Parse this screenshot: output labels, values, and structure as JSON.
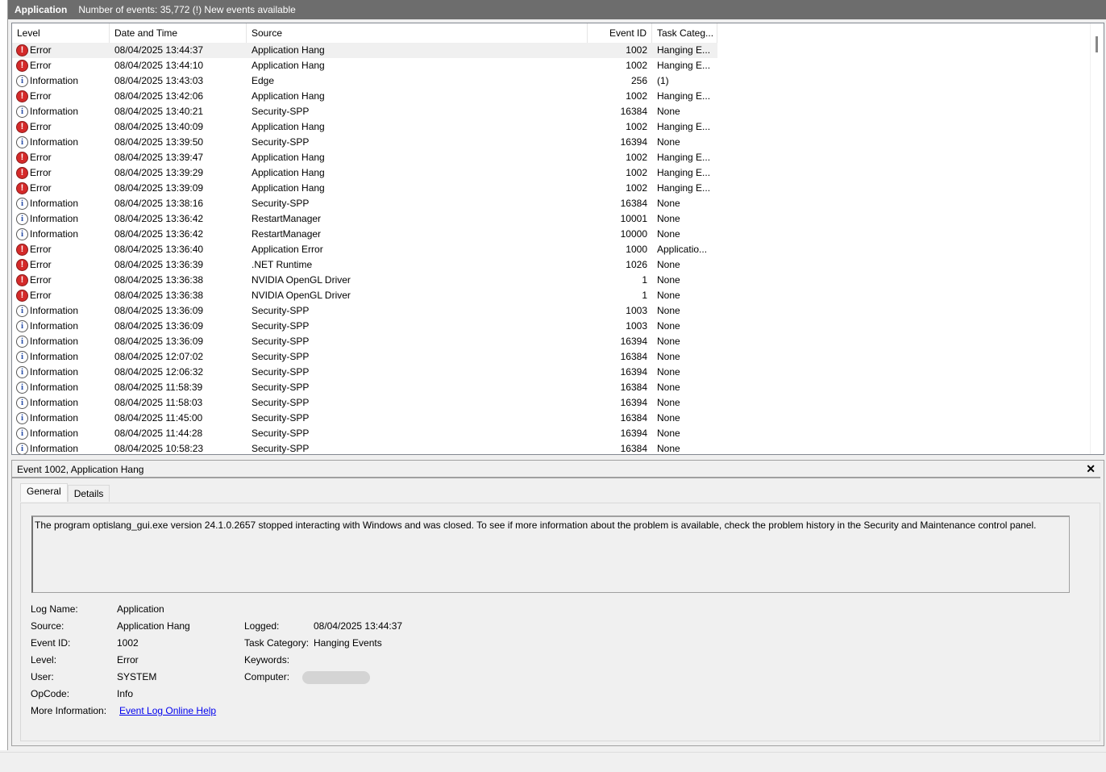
{
  "header": {
    "log": "Application",
    "status": "Number of events: 35,772 (!) New events available"
  },
  "columns": [
    "Level",
    "Date and Time",
    "Source",
    "Event ID",
    "Task Categ..."
  ],
  "events": [
    [
      "error",
      "Error",
      "08/04/2025 13:44:37",
      "Application Hang",
      "1002",
      "Hanging E..."
    ],
    [
      "error",
      "Error",
      "08/04/2025 13:44:10",
      "Application Hang",
      "1002",
      "Hanging E..."
    ],
    [
      "info",
      "Information",
      "08/04/2025 13:43:03",
      "Edge",
      "256",
      "(1)"
    ],
    [
      "error",
      "Error",
      "08/04/2025 13:42:06",
      "Application Hang",
      "1002",
      "Hanging E..."
    ],
    [
      "info",
      "Information",
      "08/04/2025 13:40:21",
      "Security-SPP",
      "16384",
      "None"
    ],
    [
      "error",
      "Error",
      "08/04/2025 13:40:09",
      "Application Hang",
      "1002",
      "Hanging E..."
    ],
    [
      "info",
      "Information",
      "08/04/2025 13:39:50",
      "Security-SPP",
      "16394",
      "None"
    ],
    [
      "error",
      "Error",
      "08/04/2025 13:39:47",
      "Application Hang",
      "1002",
      "Hanging E..."
    ],
    [
      "error",
      "Error",
      "08/04/2025 13:39:29",
      "Application Hang",
      "1002",
      "Hanging E..."
    ],
    [
      "error",
      "Error",
      "08/04/2025 13:39:09",
      "Application Hang",
      "1002",
      "Hanging E..."
    ],
    [
      "info",
      "Information",
      "08/04/2025 13:38:16",
      "Security-SPP",
      "16384",
      "None"
    ],
    [
      "info",
      "Information",
      "08/04/2025 13:36:42",
      "RestartManager",
      "10001",
      "None"
    ],
    [
      "info",
      "Information",
      "08/04/2025 13:36:42",
      "RestartManager",
      "10000",
      "None"
    ],
    [
      "error",
      "Error",
      "08/04/2025 13:36:40",
      "Application Error",
      "1000",
      "Applicatio..."
    ],
    [
      "error",
      "Error",
      "08/04/2025 13:36:39",
      ".NET Runtime",
      "1026",
      "None"
    ],
    [
      "error",
      "Error",
      "08/04/2025 13:36:38",
      "NVIDIA OpenGL Driver",
      "1",
      "None"
    ],
    [
      "error",
      "Error",
      "08/04/2025 13:36:38",
      "NVIDIA OpenGL Driver",
      "1",
      "None"
    ],
    [
      "info",
      "Information",
      "08/04/2025 13:36:09",
      "Security-SPP",
      "1003",
      "None"
    ],
    [
      "info",
      "Information",
      "08/04/2025 13:36:09",
      "Security-SPP",
      "1003",
      "None"
    ],
    [
      "info",
      "Information",
      "08/04/2025 13:36:09",
      "Security-SPP",
      "16394",
      "None"
    ],
    [
      "info",
      "Information",
      "08/04/2025 12:07:02",
      "Security-SPP",
      "16384",
      "None"
    ],
    [
      "info",
      "Information",
      "08/04/2025 12:06:32",
      "Security-SPP",
      "16394",
      "None"
    ],
    [
      "info",
      "Information",
      "08/04/2025 11:58:39",
      "Security-SPP",
      "16384",
      "None"
    ],
    [
      "info",
      "Information",
      "08/04/2025 11:58:03",
      "Security-SPP",
      "16394",
      "None"
    ],
    [
      "info",
      "Information",
      "08/04/2025 11:45:00",
      "Security-SPP",
      "16384",
      "None"
    ],
    [
      "info",
      "Information",
      "08/04/2025 11:44:28",
      "Security-SPP",
      "16394",
      "None"
    ],
    [
      "info",
      "Information",
      "08/04/2025 10:58:23",
      "Security-SPP",
      "16384",
      "None"
    ]
  ],
  "detail": {
    "title": "Event 1002, Application Hang",
    "close": "✕",
    "tabs": [
      "General",
      "Details"
    ],
    "description": "The program optislang_gui.exe version 24.1.0.2657 stopped interacting with Windows and was closed. To see if more information about the problem is available, check the problem history in the Security and Maintenance control panel.",
    "log_name_label": "Log Name:",
    "log_name": "Application",
    "source_label": "Source:",
    "source": "Application Hang",
    "logged_label": "Logged:",
    "logged": "08/04/2025 13:44:37",
    "event_id_label": "Event ID:",
    "event_id": "1002",
    "task_label": "Task Category:",
    "task": "Hanging Events",
    "level_label": "Level:",
    "level": "Error",
    "keywords_label": "Keywords:",
    "user_label": "User:",
    "user": "SYSTEM",
    "computer_label": "Computer:",
    "opcode_label": "OpCode:",
    "opcode": "Info",
    "more_label": "More Information:",
    "more_link": "Event Log Online Help"
  }
}
